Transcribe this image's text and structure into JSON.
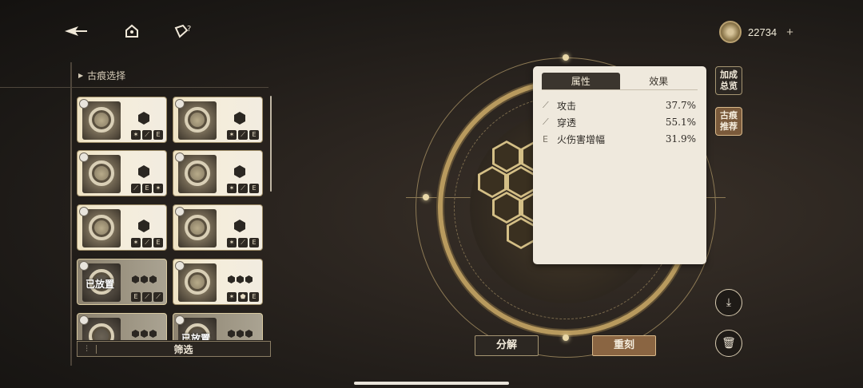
{
  "topbar": {
    "back_icon": "back-arrow-icon",
    "home_icon": "home-icon",
    "help_icon": "help-icon",
    "currency_value": "22734",
    "currency_plus": "+"
  },
  "left_panel": {
    "title": "古痕选择",
    "placed_label": "已放置",
    "filter_label": "筛选",
    "filter_icon_glyph": "⫶"
  },
  "stats": {
    "tabs": [
      "属性",
      "效果"
    ],
    "rows": [
      {
        "icon": "⟋",
        "label": "攻击",
        "value": "37.7%"
      },
      {
        "icon": "⟋",
        "label": "穿透",
        "value": "55.1%"
      },
      {
        "icon": "E",
        "label": "火伤害增幅",
        "value": "31.9%"
      }
    ]
  },
  "side_buttons": {
    "overview": "加成总览",
    "recommend": "古痕推荐"
  },
  "round_buttons": {
    "save_icon": "download-icon",
    "delete_icon": "trash-icon"
  },
  "actions": {
    "dismantle": "分解",
    "reforge": "重刻"
  }
}
